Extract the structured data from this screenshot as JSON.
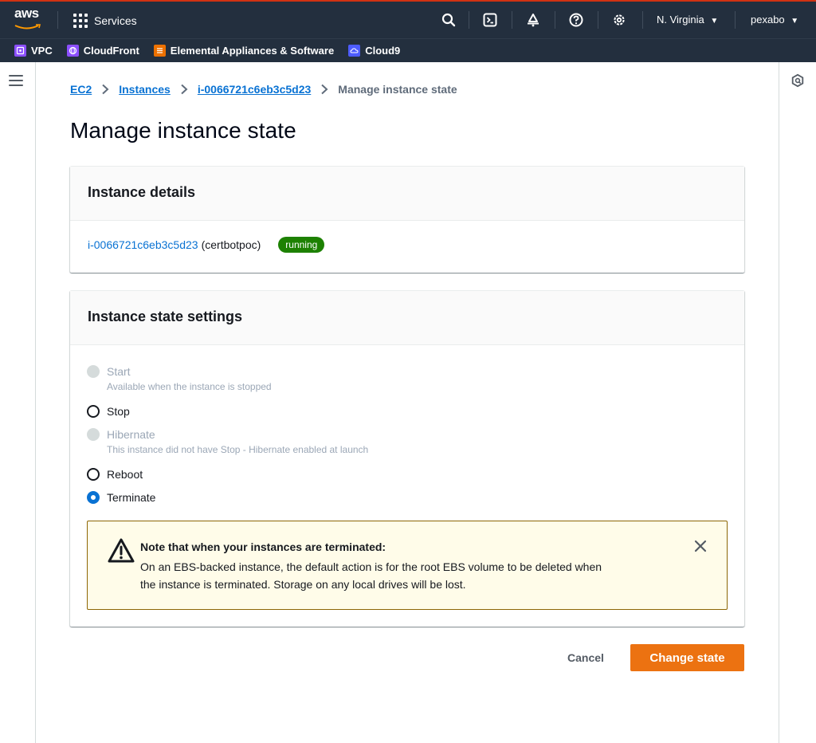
{
  "topnav": {
    "logo_text": "aws",
    "services_label": "Services",
    "region_label": "N. Virginia",
    "account_label": "pexabo"
  },
  "favorites": [
    {
      "label": "VPC",
      "color": "#8c4fff"
    },
    {
      "label": "CloudFront",
      "color": "#8c4fff"
    },
    {
      "label": "Elemental Appliances & Software",
      "color": "#ed7100"
    },
    {
      "label": "Cloud9",
      "color": "#4d5cff"
    }
  ],
  "breadcrumb": {
    "items": [
      "EC2",
      "Instances",
      "i-0066721c6eb3c5d23"
    ],
    "current": "Manage instance state"
  },
  "page_title": "Manage instance state",
  "instance_details": {
    "header": "Instance details",
    "instance_id": "i-0066721c6eb3c5d23",
    "instance_name": "(certbotpoc)",
    "status": "running",
    "status_color": "#1d8102"
  },
  "state_settings": {
    "header": "Instance state settings",
    "options": [
      {
        "label": "Start",
        "description": "Available when the instance is stopped",
        "disabled": true,
        "checked": false
      },
      {
        "label": "Stop",
        "description": "",
        "disabled": false,
        "checked": false
      },
      {
        "label": "Hibernate",
        "description": "This instance did not have Stop - Hibernate enabled at launch",
        "disabled": true,
        "checked": false
      },
      {
        "label": "Reboot",
        "description": "",
        "disabled": false,
        "checked": false
      },
      {
        "label": "Terminate",
        "description": "",
        "disabled": false,
        "checked": true
      }
    ]
  },
  "alert": {
    "title": "Note that when your instances are terminated:",
    "line1": "On an EBS-backed instance, the default action is for the root EBS volume to be deleted when",
    "line2": "the instance is terminated. Storage on any local drives will be lost."
  },
  "actions": {
    "cancel_label": "Cancel",
    "submit_label": "Change state"
  },
  "colors": {
    "accent": "#0972d3",
    "primary_button": "#ec7211",
    "nav_bg": "#232f3e"
  }
}
